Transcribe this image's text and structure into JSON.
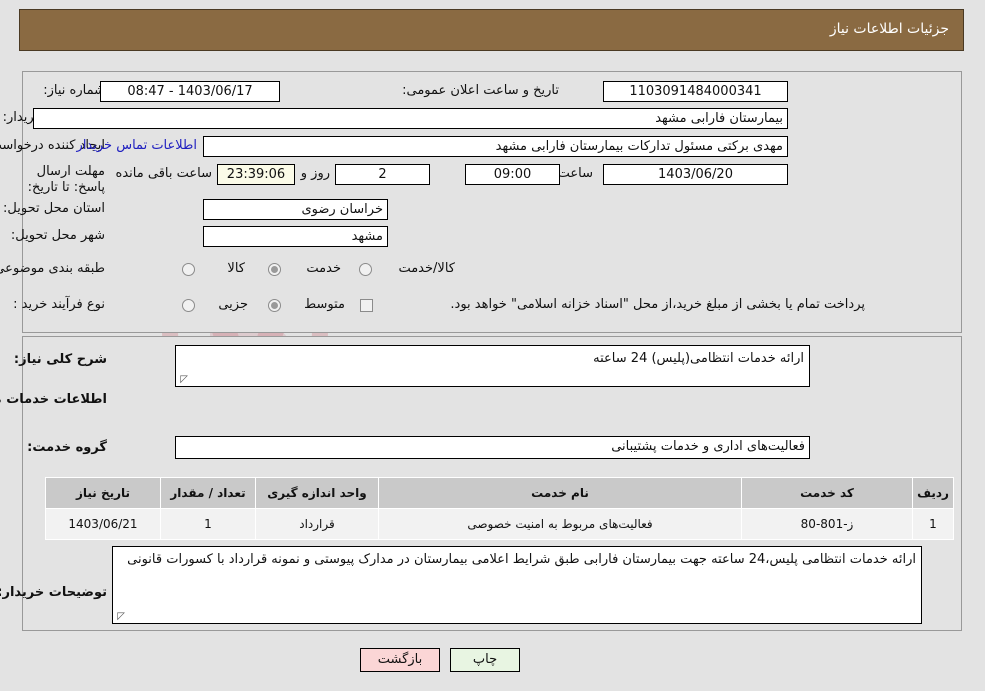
{
  "header": {
    "title": "جزئیات اطلاعات نیاز"
  },
  "top_form": {
    "need_number_label": "شماره نیاز:",
    "need_number_value": "1103091484000341",
    "announce_datetime_label": "تاریخ و ساعت اعلان عمومی:",
    "announce_datetime_value": "1403/06/17 - 08:47",
    "buyer_org_label": "نام دستگاه خریدار:",
    "buyer_org_value": "بیمارستان فارابی مشهد",
    "creator_label": "ایجاد کننده درخواست:",
    "creator_value": "مهدی برکتی مسئول تدارکات بیمارستان فارابی مشهد",
    "buyer_contact_link": "اطلاعات تماس خریدار",
    "deadline_label": "مهلت ارسال پاسخ: تا تاریخ:",
    "deadline_date_value": "1403/06/20",
    "hour_label": "ساعت",
    "deadline_hour_value": "09:00",
    "days_value": "2",
    "days_label": "روز و",
    "countdown_value": "23:39:06",
    "remaining_label": "ساعت باقی مانده",
    "province_label": "استان محل تحویل:",
    "province_value": "خراسان رضوی",
    "city_label": "شهر محل تحویل:",
    "city_value": "مشهد",
    "category_label": "طبقه بندی موضوعی:",
    "category_options": [
      {
        "label": "کالا",
        "selected": false
      },
      {
        "label": "خدمت",
        "selected": true
      },
      {
        "label": "کالا/خدمت",
        "selected": false
      }
    ],
    "process_type_label": "نوع فرآیند خرید :",
    "process_options": [
      {
        "label": "جزیی",
        "selected": false
      },
      {
        "label": "متوسط",
        "selected": true
      }
    ],
    "treasury_checkbox_label": "پرداخت تمام یا بخشی از مبلغ خرید،از محل \"اسناد خزانه اسلامی\" خواهد بود.",
    "treasury_checked": false
  },
  "description": {
    "label": "شرح کلی نیاز:",
    "value": "ارائه خدمات انتظامی(پلیس) 24 ساعته"
  },
  "services_section": {
    "heading": "اطلاعات خدمات مورد نیاز",
    "group_label": "گروه خدمت:",
    "group_value": "فعالیت‌های اداری و خدمات پشتیبانی"
  },
  "table": {
    "headers": [
      "ردیف",
      "کد خدمت",
      "نام خدمت",
      "واحد اندازه گیری",
      "تعداد / مقدار",
      "تاریخ نیاز"
    ],
    "rows": [
      {
        "row": "1",
        "code": "ز-801-80",
        "name": "فعالیت‌های مربوط به امنیت خصوصی",
        "unit": "قرارداد",
        "qty": "1",
        "date": "1403/06/21"
      }
    ]
  },
  "buyer_notes": {
    "label": "توضیحات خریدار:",
    "value": "ارائه خدمات انتظامی پلیس،24 ساعته جهت بیمارستان فارابی طبق شرایط اعلامی بیمارستان در مدارک پیوستی و نمونه قرارداد با کسورات قانونی"
  },
  "buttons": {
    "print": "چاپ",
    "back": "بازگشت"
  },
  "watermark": {
    "text": "AriaTender.net"
  },
  "colors": {
    "header_bg": "#8a6a42",
    "page_bg": "#e3e3e3",
    "link": "#2020c0",
    "print_btn": "#e8f5e2",
    "back_btn": "#fbd6d6",
    "countdown_bg": "#fbfbe8"
  }
}
